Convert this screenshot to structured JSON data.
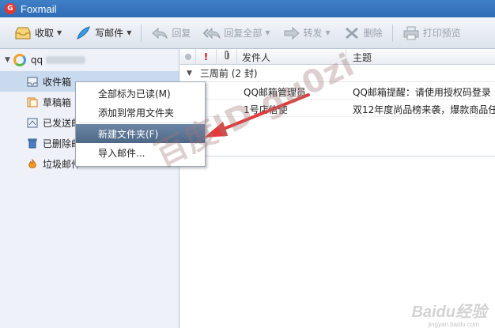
{
  "window": {
    "title": "Foxmail",
    "logo_letter": "G"
  },
  "toolbar": {
    "receive": "收取",
    "compose": "写邮件",
    "reply": "回复",
    "reply_all": "回复全部",
    "forward": "转发",
    "delete": "删除",
    "print_preview": "打印预览"
  },
  "sidebar": {
    "account_name": "qq",
    "folders": [
      "收件箱",
      "草稿箱",
      "已发送邮件",
      "已删除邮件",
      "垃圾邮件"
    ]
  },
  "list": {
    "columns": {
      "sender": "发件人",
      "subject": "主题"
    },
    "group_label": "三周前 (2 封)",
    "rows": [
      {
        "sender": "QQ邮箱管理员",
        "subject": "QQ邮箱提醒：请使用授权码登录"
      },
      {
        "sender": "1号店信使",
        "subject": "双12年度尚品榜来袭，爆款商品任"
      }
    ]
  },
  "context_menu": {
    "items": [
      "全部标为已读(M)",
      "添加到常用文件夹",
      "新建文件夹(F)",
      "导入邮件..."
    ],
    "highlighted_index": 2
  },
  "watermark": {
    "text": "百度ID gu0zi",
    "brand": "Baidu经验",
    "brand_sub": "jingyan.baidu.com"
  },
  "colors": {
    "titlebar": "#2f6cb5",
    "selection": "#c9d9ee",
    "menu_highlight": "#4d6787",
    "arrow": "#e23b3b"
  }
}
